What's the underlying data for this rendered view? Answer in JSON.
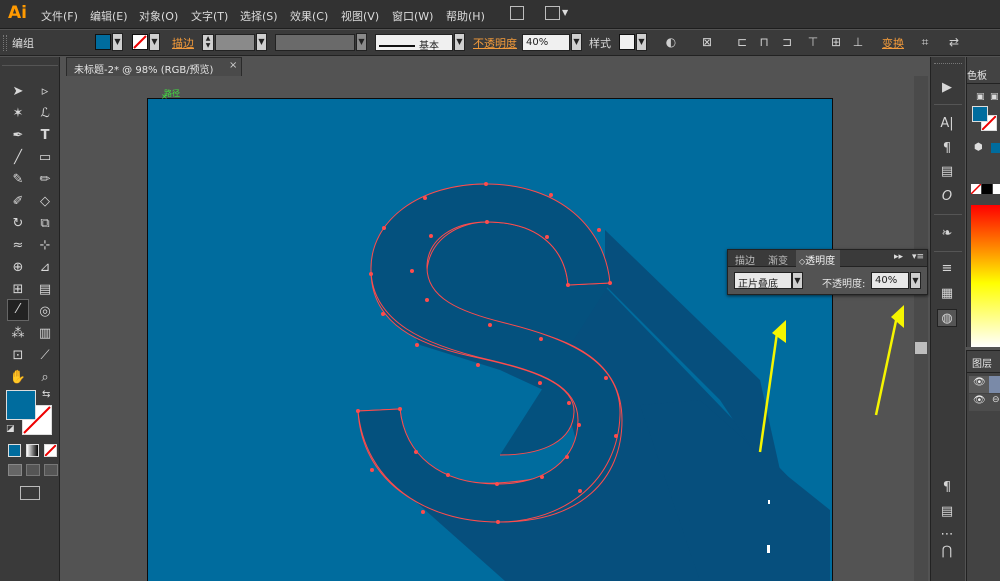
{
  "app": {
    "logo": "Ai"
  },
  "menu": [
    "文件(F)",
    "编辑(E)",
    "对象(O)",
    "文字(T)",
    "选择(S)",
    "效果(C)",
    "视图(V)",
    "窗口(W)",
    "帮助(H)"
  ],
  "control_bar": {
    "selection": "编组",
    "stroke_label": "描边",
    "stroke_profile": "基本",
    "opacity_label": "不透明度",
    "opacity_value": "40%",
    "style_label": "样式",
    "transform_label": "变换"
  },
  "document": {
    "tab_title": "未标题-2* @ 98% (RGB/预览)",
    "close": "×",
    "selection_label": "路径"
  },
  "colors": {
    "fill": "#006c9e",
    "artboard": "#006c9e",
    "letter": "#04517e",
    "shadow": "#064f7d",
    "path_stroke": "#ff4c4c",
    "arrow": "#f5f500",
    "ui_bg": "#535353",
    "ui_panel": "#3a3a3a",
    "orange_label": "#f29a3a"
  },
  "transparency_panel": {
    "tabs": [
      "描边",
      "渐变",
      "透明度"
    ],
    "active_tab": "透明度",
    "blend_mode": "正片叠底",
    "opacity_label": "不透明度:",
    "opacity_value": "40%"
  },
  "right_panels": {
    "color_tab": "色板",
    "layers_tab": "图层"
  },
  "icons": {
    "toolbar": [
      "selection-tool-icon",
      "direct-selection-tool-icon",
      "magic-wand-icon",
      "lasso-icon",
      "pen-tool-icon",
      "type-tool-icon",
      "line-tool-icon",
      "rectangle-tool-icon",
      "paintbrush-icon",
      "pencil-icon",
      "blob-brush-icon",
      "eraser-icon",
      "rotate-icon",
      "scale-icon",
      "warp-icon",
      "free-transform-icon",
      "shape-builder-icon",
      "perspective-grid-icon",
      "mesh-icon",
      "gradient-icon",
      "eyedropper-icon",
      "blend-icon",
      "symbol-sprayer-icon",
      "column-graph-icon",
      "artboard-tool-icon",
      "slice-icon",
      "hand-icon",
      "zoom-icon"
    ]
  }
}
